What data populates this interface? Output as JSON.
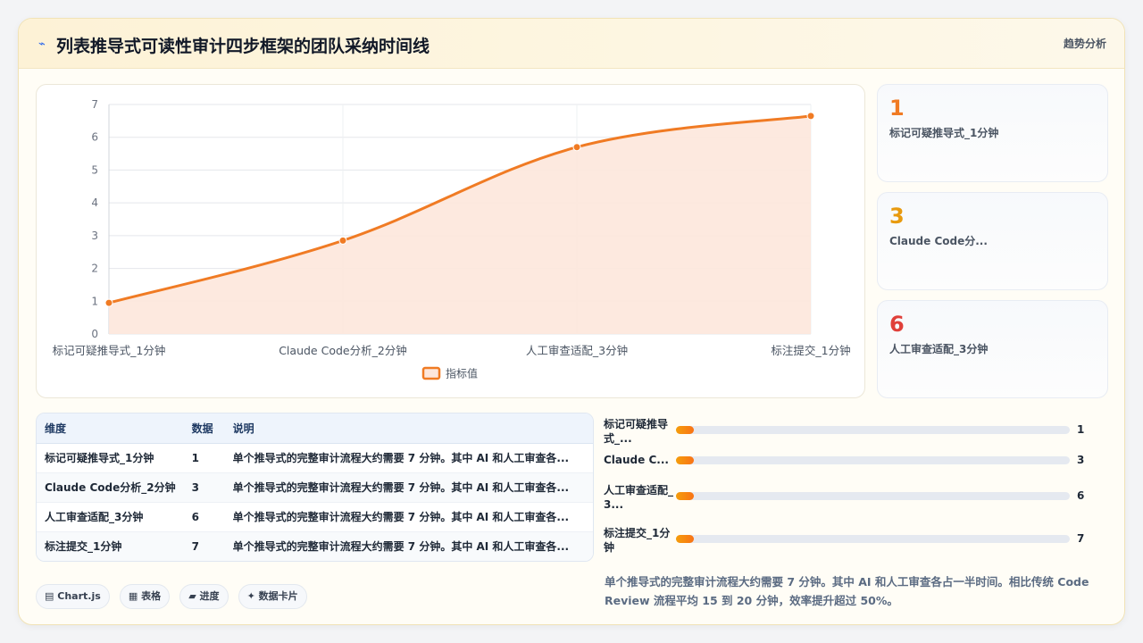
{
  "header": {
    "icon": "trend-line-icon",
    "title": "列表推导式可读性审计四步框架的团队采纳时间线",
    "tag": "趋势分析"
  },
  "chart_data": {
    "type": "area",
    "categories": [
      "标记可疑推导式_1分钟",
      "Claude Code分析_2分钟",
      "人工审查适配_3分钟",
      "标注提交_1分钟"
    ],
    "series": [
      {
        "name": "指标值",
        "values": [
          1,
          3,
          6,
          7
        ],
        "color": "#f07b24"
      }
    ],
    "plotted_values": [
      0.95,
      2.85,
      5.7,
      6.65
    ],
    "ylim": [
      0,
      7
    ],
    "yticks": [
      "0",
      "1",
      "2",
      "3",
      "4",
      "5",
      "6",
      "7"
    ],
    "grid": true,
    "legend_position": "bottom",
    "fill_color": "#fde7dc"
  },
  "stats": [
    {
      "value": "1",
      "label": "标记可疑推导式_1分钟",
      "color": "#f07b24"
    },
    {
      "value": "3",
      "label": "Claude Code分...",
      "color": "#e89a0e"
    },
    {
      "value": "6",
      "label": "人工审查适配_3分钟",
      "color": "#e0403a"
    }
  ],
  "table": {
    "headers": [
      "维度",
      "数据",
      "说明"
    ],
    "rows": [
      {
        "dim": "标记可疑推导式_1分钟",
        "val": "1",
        "desc": "单个推导式的完整审计流程大约需要 7 分钟。其中 AI 和人工审查各..."
      },
      {
        "dim": "Claude Code分析_2分钟",
        "val": "3",
        "desc": "单个推导式的完整审计流程大约需要 7 分钟。其中 AI 和人工审查各..."
      },
      {
        "dim": "人工审查适配_3分钟",
        "val": "6",
        "desc": "单个推导式的完整审计流程大约需要 7 分钟。其中 AI 和人工审查各..."
      },
      {
        "dim": "标注提交_1分钟",
        "val": "7",
        "desc": "单个推导式的完整审计流程大约需要 7 分钟。其中 AI 和人工审查各..."
      }
    ]
  },
  "progress": {
    "max": 7,
    "items": [
      {
        "label": "标记可疑推导式_...",
        "value": 1,
        "display": "1",
        "fill": 0.045
      },
      {
        "label": "Claude C...",
        "value": 3,
        "display": "3",
        "fill": 0.045
      },
      {
        "label": "人工审查适配_3...",
        "value": 6,
        "display": "6",
        "fill": 0.045
      },
      {
        "label": "标注提交_1分钟",
        "value": 7,
        "display": "7",
        "fill": 0.045
      }
    ]
  },
  "note": "单个推导式的完整审计流程大约需要 7 分钟。其中 AI 和人工审查各占一半时间。相比传统 Code Review 流程平均 15 到 20 分钟，效率提升超过 50%。",
  "chips": [
    {
      "label": "Chart.js",
      "icon": "chart-icon",
      "glyph": "▤"
    },
    {
      "label": "表格",
      "icon": "table-icon",
      "glyph": "▦"
    },
    {
      "label": "进度",
      "icon": "progress-icon",
      "glyph": "▰"
    },
    {
      "label": "数据卡片",
      "icon": "sparkle-icon",
      "glyph": "✦"
    }
  ]
}
